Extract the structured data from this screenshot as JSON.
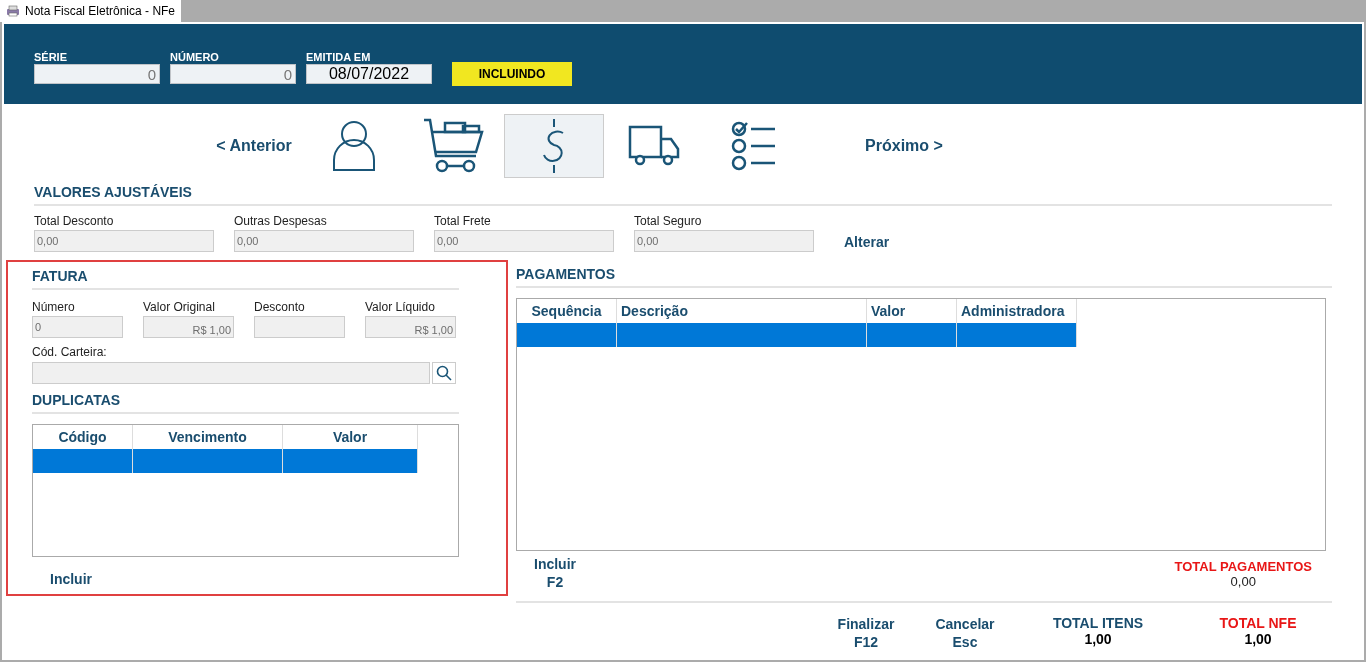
{
  "window": {
    "title": "Nota Fiscal Eletrônica - NFe"
  },
  "header": {
    "fields": [
      {
        "label": "SÉRIE",
        "value": "0",
        "kind": "number"
      },
      {
        "label": "NÚMERO",
        "value": "0",
        "kind": "number"
      },
      {
        "label": "EMITIDA EM",
        "value": "08/07/2022",
        "kind": "date"
      }
    ],
    "status": "INCLUINDO"
  },
  "steps": {
    "previous": "< Anterior",
    "next": "Próximo >",
    "items": [
      {
        "kind": "customer",
        "selected": false
      },
      {
        "kind": "cart",
        "selected": false
      },
      {
        "kind": "payment",
        "selected": true
      },
      {
        "kind": "shipping",
        "selected": false
      },
      {
        "kind": "checklist",
        "selected": false
      }
    ]
  },
  "valores_ajustaveis": {
    "title": "VALORES AJUSTÁVEIS",
    "fields": [
      {
        "label": "Total Desconto",
        "value": "0,00"
      },
      {
        "label": "Outras Despesas",
        "value": "0,00"
      },
      {
        "label": "Total Frete",
        "value": "0,00"
      },
      {
        "label": "Total Seguro",
        "value": "0,00"
      }
    ],
    "button": "Alterar"
  },
  "fatura": {
    "title": "FATURA",
    "fields": [
      {
        "label": "Número",
        "value": "0",
        "kind": "plain"
      },
      {
        "label": "Valor Original",
        "value": "R$ 1,00",
        "kind": "currency"
      },
      {
        "label": "Desconto",
        "kind": "currency"
      },
      {
        "label": "Valor Líquido",
        "value": "R$ 1,00",
        "kind": "currency"
      }
    ],
    "carteira_label": "Cód. Carteira:"
  },
  "duplicatas": {
    "title": "DUPLICATAS",
    "columns": [
      "Código",
      "Vencimento",
      "Valor"
    ],
    "rows": [
      {
        "selected": true
      }
    ],
    "button": "Incluir"
  },
  "pagamentos": {
    "title": "PAGAMENTOS",
    "columns": [
      "Sequência",
      "Descrição",
      "Valor",
      "Administradora"
    ],
    "rows": [
      {
        "selected": true
      }
    ],
    "button": [
      "Incluir",
      "F2"
    ],
    "total_label": "TOTAL PAGAMENTOS",
    "total_value": "0,00"
  },
  "footer": {
    "buttons": [
      [
        "Finalizar",
        "F12"
      ],
      [
        "Cancelar",
        "Esc"
      ]
    ],
    "totals": [
      {
        "label": "TOTAL ITENS",
        "value": "1,00",
        "highlight": false
      },
      {
        "label": "TOTAL NFE",
        "value": "1,00",
        "highlight": true
      }
    ]
  }
}
